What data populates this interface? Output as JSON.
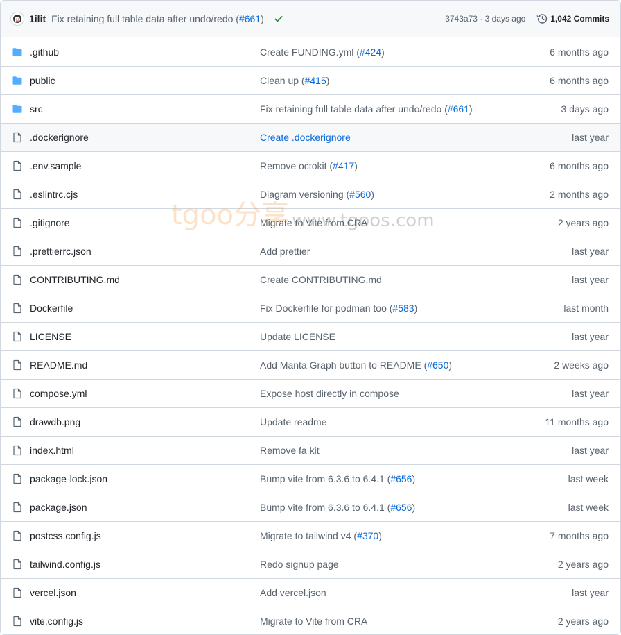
{
  "header": {
    "author": "1ilit",
    "commit_message": "Fix retaining full table data after undo/redo (",
    "commit_pr": "#661",
    "commit_close": ")",
    "sha_time": "3743a73 · 3 days ago",
    "commits_label": "1,042 Commits",
    "status_color": "#1a7f37"
  },
  "files": [
    {
      "type": "folder",
      "name": ".github",
      "message": "Create FUNDING.yml (",
      "pr": "#424",
      "close": ")",
      "time": "6 months ago"
    },
    {
      "type": "folder",
      "name": "public",
      "message": "Clean up (",
      "pr": "#415",
      "close": ")",
      "time": "6 months ago"
    },
    {
      "type": "folder",
      "name": "src",
      "message": "Fix retaining full table data after undo/redo (",
      "pr": "#661",
      "close": ")",
      "time": "3 days ago"
    },
    {
      "type": "file",
      "name": ".dockerignore",
      "message": "Create .dockerignore",
      "pr": "",
      "close": "",
      "time": "last year",
      "hover": true
    },
    {
      "type": "file",
      "name": ".env.sample",
      "message": "Remove octokit (",
      "pr": "#417",
      "close": ")",
      "time": "6 months ago"
    },
    {
      "type": "file",
      "name": ".eslintrc.cjs",
      "message": "Diagram versioning (",
      "pr": "#560",
      "close": ")",
      "time": "2 months ago"
    },
    {
      "type": "file",
      "name": ".gitignore",
      "message": "Migrate to Vite from CRA",
      "pr": "",
      "close": "",
      "time": "2 years ago"
    },
    {
      "type": "file",
      "name": ".prettierrc.json",
      "message": "Add prettier",
      "pr": "",
      "close": "",
      "time": "last year"
    },
    {
      "type": "file",
      "name": "CONTRIBUTING.md",
      "message": "Create CONTRIBUTING.md",
      "pr": "",
      "close": "",
      "time": "last year"
    },
    {
      "type": "file",
      "name": "Dockerfile",
      "message": "Fix Dockerfile for podman too (",
      "pr": "#583",
      "close": ")",
      "time": "last month"
    },
    {
      "type": "file",
      "name": "LICENSE",
      "message": "Update LICENSE",
      "pr": "",
      "close": "",
      "time": "last year"
    },
    {
      "type": "file",
      "name": "README.md",
      "message": "Add Manta Graph button to README (",
      "pr": "#650",
      "close": ")",
      "time": "2 weeks ago"
    },
    {
      "type": "file",
      "name": "compose.yml",
      "message": "Expose host directly in compose",
      "pr": "",
      "close": "",
      "time": "last year"
    },
    {
      "type": "file",
      "name": "drawdb.png",
      "message": "Update readme",
      "pr": "",
      "close": "",
      "time": "11 months ago"
    },
    {
      "type": "file",
      "name": "index.html",
      "message": "Remove fa kit",
      "pr": "",
      "close": "",
      "time": "last year"
    },
    {
      "type": "file",
      "name": "package-lock.json",
      "message": "Bump vite from 6.3.6 to 6.4.1 (",
      "pr": "#656",
      "close": ")",
      "time": "last week"
    },
    {
      "type": "file",
      "name": "package.json",
      "message": "Bump vite from 6.3.6 to 6.4.1 (",
      "pr": "#656",
      "close": ")",
      "time": "last week"
    },
    {
      "type": "file",
      "name": "postcss.config.js",
      "message": "Migrate to tailwind v4 (",
      "pr": "#370",
      "close": ")",
      "time": "7 months ago"
    },
    {
      "type": "file",
      "name": "tailwind.config.js",
      "message": "Redo signup page",
      "pr": "",
      "close": "",
      "time": "2 years ago"
    },
    {
      "type": "file",
      "name": "vercel.json",
      "message": "Add vercel.json",
      "pr": "",
      "close": "",
      "time": "last year"
    },
    {
      "type": "file",
      "name": "vite.config.js",
      "message": "Migrate to Vite from CRA",
      "pr": "",
      "close": "",
      "time": "2 years ago"
    }
  ],
  "watermark": {
    "brand": "tgoo分享",
    "url": "www.tgoos.com"
  },
  "colors": {
    "folder": "#54aeff",
    "file_icon": "#59636e",
    "link": "#0969da"
  }
}
